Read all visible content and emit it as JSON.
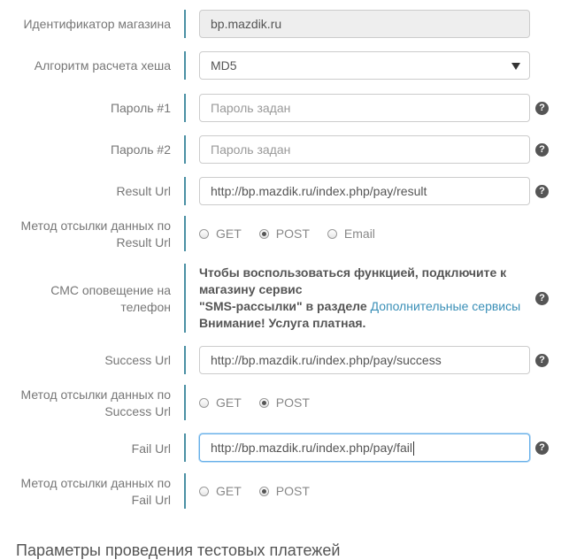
{
  "shop_id": {
    "label": "Идентификатор магазина",
    "value": "bp.mazdik.ru"
  },
  "hash_algorithm": {
    "label": "Алгоритм расчета хеша",
    "value": "MD5"
  },
  "password1": {
    "label": "Пароль #1",
    "placeholder": "Пароль задан"
  },
  "password2": {
    "label": "Пароль #2",
    "placeholder": "Пароль задан"
  },
  "result_url": {
    "label": "Result Url",
    "value": "http://bp.mazdik.ru/index.php/pay/result"
  },
  "result_method": {
    "label_line1": "Метод отсылки данных по",
    "label_line2": "Result Url",
    "options": [
      "GET",
      "POST",
      "Email"
    ],
    "selected": "POST"
  },
  "sms": {
    "label_line1": "СМС оповещение на",
    "label_line2": "телефон",
    "text_line1": "Чтобы воспользоваться функцией, подключите к",
    "text_line2": "магазину сервис",
    "text_line3_prefix": "\"SMS-рассылки\" в разделе",
    "link_text": "Дополнительные сервисы",
    "text_line4": "Внимание! Услуга платная."
  },
  "success_url": {
    "label": "Success Url",
    "value": "http://bp.mazdik.ru/index.php/pay/success"
  },
  "success_method": {
    "label_line1": "Метод отсылки данных по",
    "label_line2": "Success Url",
    "options": [
      "GET",
      "POST"
    ],
    "selected": "POST"
  },
  "fail_url": {
    "label": "Fail Url",
    "value": "http://bp.mazdik.ru/index.php/pay/fail"
  },
  "fail_method": {
    "label_line1": "Метод отсылки данных по",
    "label_line2": "Fail Url",
    "options": [
      "GET",
      "POST"
    ],
    "selected": "POST"
  },
  "help_icon": "?",
  "section_title": "Параметры проведения тестовых платежей",
  "colors": {
    "divider": "#4a90a4",
    "link": "#3a8fb7",
    "focus_border": "#66afe9"
  }
}
